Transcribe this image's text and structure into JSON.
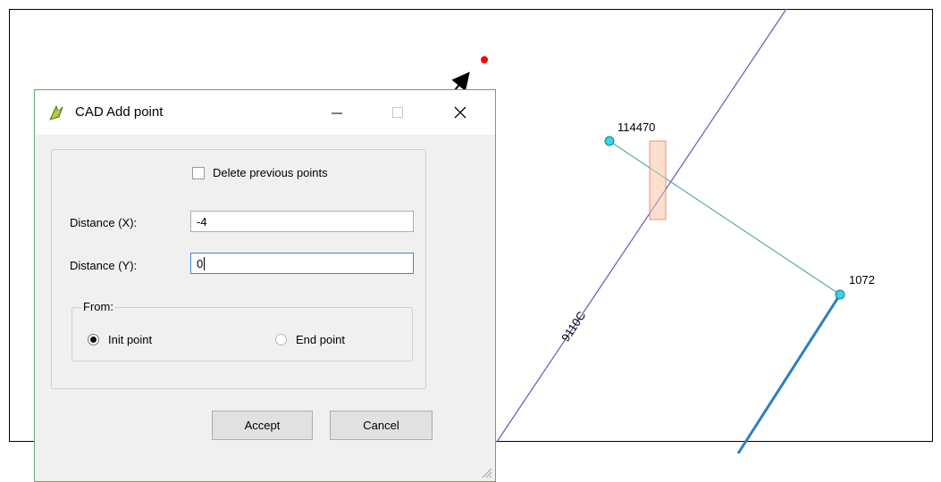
{
  "map": {
    "nodes": [
      {
        "id": "node-114470",
        "label": "114470"
      },
      {
        "id": "node-1072",
        "label": "1072"
      }
    ],
    "edge_label": "9110C",
    "colors": {
      "boundary_line": "#7b5fc0",
      "connector_line": "#5fb3b0",
      "pipe_line": "#2d7fc0",
      "node_fill": "#33d6e6",
      "node_stroke": "#1f7e8a",
      "highlight_fill": "#fbd9c4",
      "highlight_stroke": "#f08f6f",
      "target_point": "#ff0000"
    }
  },
  "dialog": {
    "title": "CAD Add point",
    "title_icon": "qgis-icon",
    "delete_previous_label": "Delete previous points",
    "delete_previous_checked": false,
    "distance_x_label": "Distance (X):",
    "distance_x_value": "-4",
    "distance_y_label": "Distance (Y):",
    "distance_y_value": "0",
    "from_group_title": "From:",
    "init_point_label": "Init point",
    "end_point_label": "End point",
    "selected_origin": "Init point",
    "accept_label": "Accept",
    "cancel_label": "Cancel"
  }
}
